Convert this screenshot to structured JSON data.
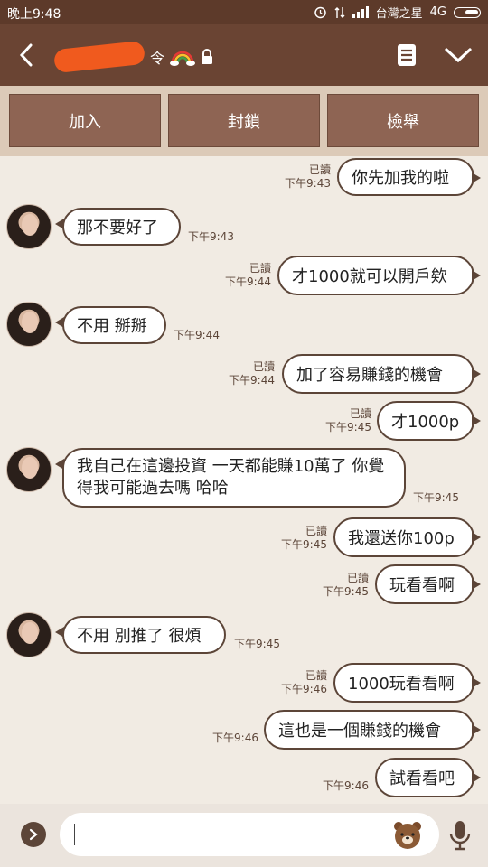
{
  "status_bar": {
    "time": "晚上9:48",
    "carrier": "台灣之星",
    "network": "4G"
  },
  "header": {
    "contact_name_suffix": "令",
    "icons": [
      "back-icon",
      "rainbow-icon",
      "lock-icon",
      "menu-icon",
      "chevron-down-icon"
    ]
  },
  "actions": {
    "add": "加入",
    "block": "封鎖",
    "report": "檢舉"
  },
  "messages": [
    {
      "dir": "out",
      "text": "你先加我的啦",
      "read": "已讀",
      "time": "下午9:43"
    },
    {
      "dir": "in",
      "text": "那不要好了",
      "time": "下午9:43"
    },
    {
      "dir": "out",
      "text": "才1000就可以開戶欸",
      "read": "已讀",
      "time": "下午9:44"
    },
    {
      "dir": "in",
      "text": "不用 掰掰",
      "time": "下午9:44"
    },
    {
      "dir": "out",
      "text": "加了容易賺錢的機會",
      "read": "已讀",
      "time": "下午9:44"
    },
    {
      "dir": "out",
      "text": "才1000p",
      "read": "已讀",
      "time": "下午9:45"
    },
    {
      "dir": "in",
      "text": "我自己在這邊投資 一天都能賺10萬了 你覺得我可能過去嗎 哈哈",
      "time": "下午9:45"
    },
    {
      "dir": "out",
      "text": "我還送你100p",
      "read": "已讀",
      "time": "下午9:45"
    },
    {
      "dir": "out",
      "text": "玩看看啊",
      "read": "已讀",
      "time": "下午9:45"
    },
    {
      "dir": "in",
      "text": "不用 別推了 很煩",
      "time": "下午9:45"
    },
    {
      "dir": "out",
      "text": "1000玩看看啊",
      "read": "已讀",
      "time": "下午9:46"
    },
    {
      "dir": "out",
      "text": "這也是一個賺錢的機會",
      "time": "下午9:46"
    },
    {
      "dir": "out",
      "text": "試看看吧",
      "time": "下午9:46"
    }
  ],
  "input": {
    "placeholder": ""
  }
}
